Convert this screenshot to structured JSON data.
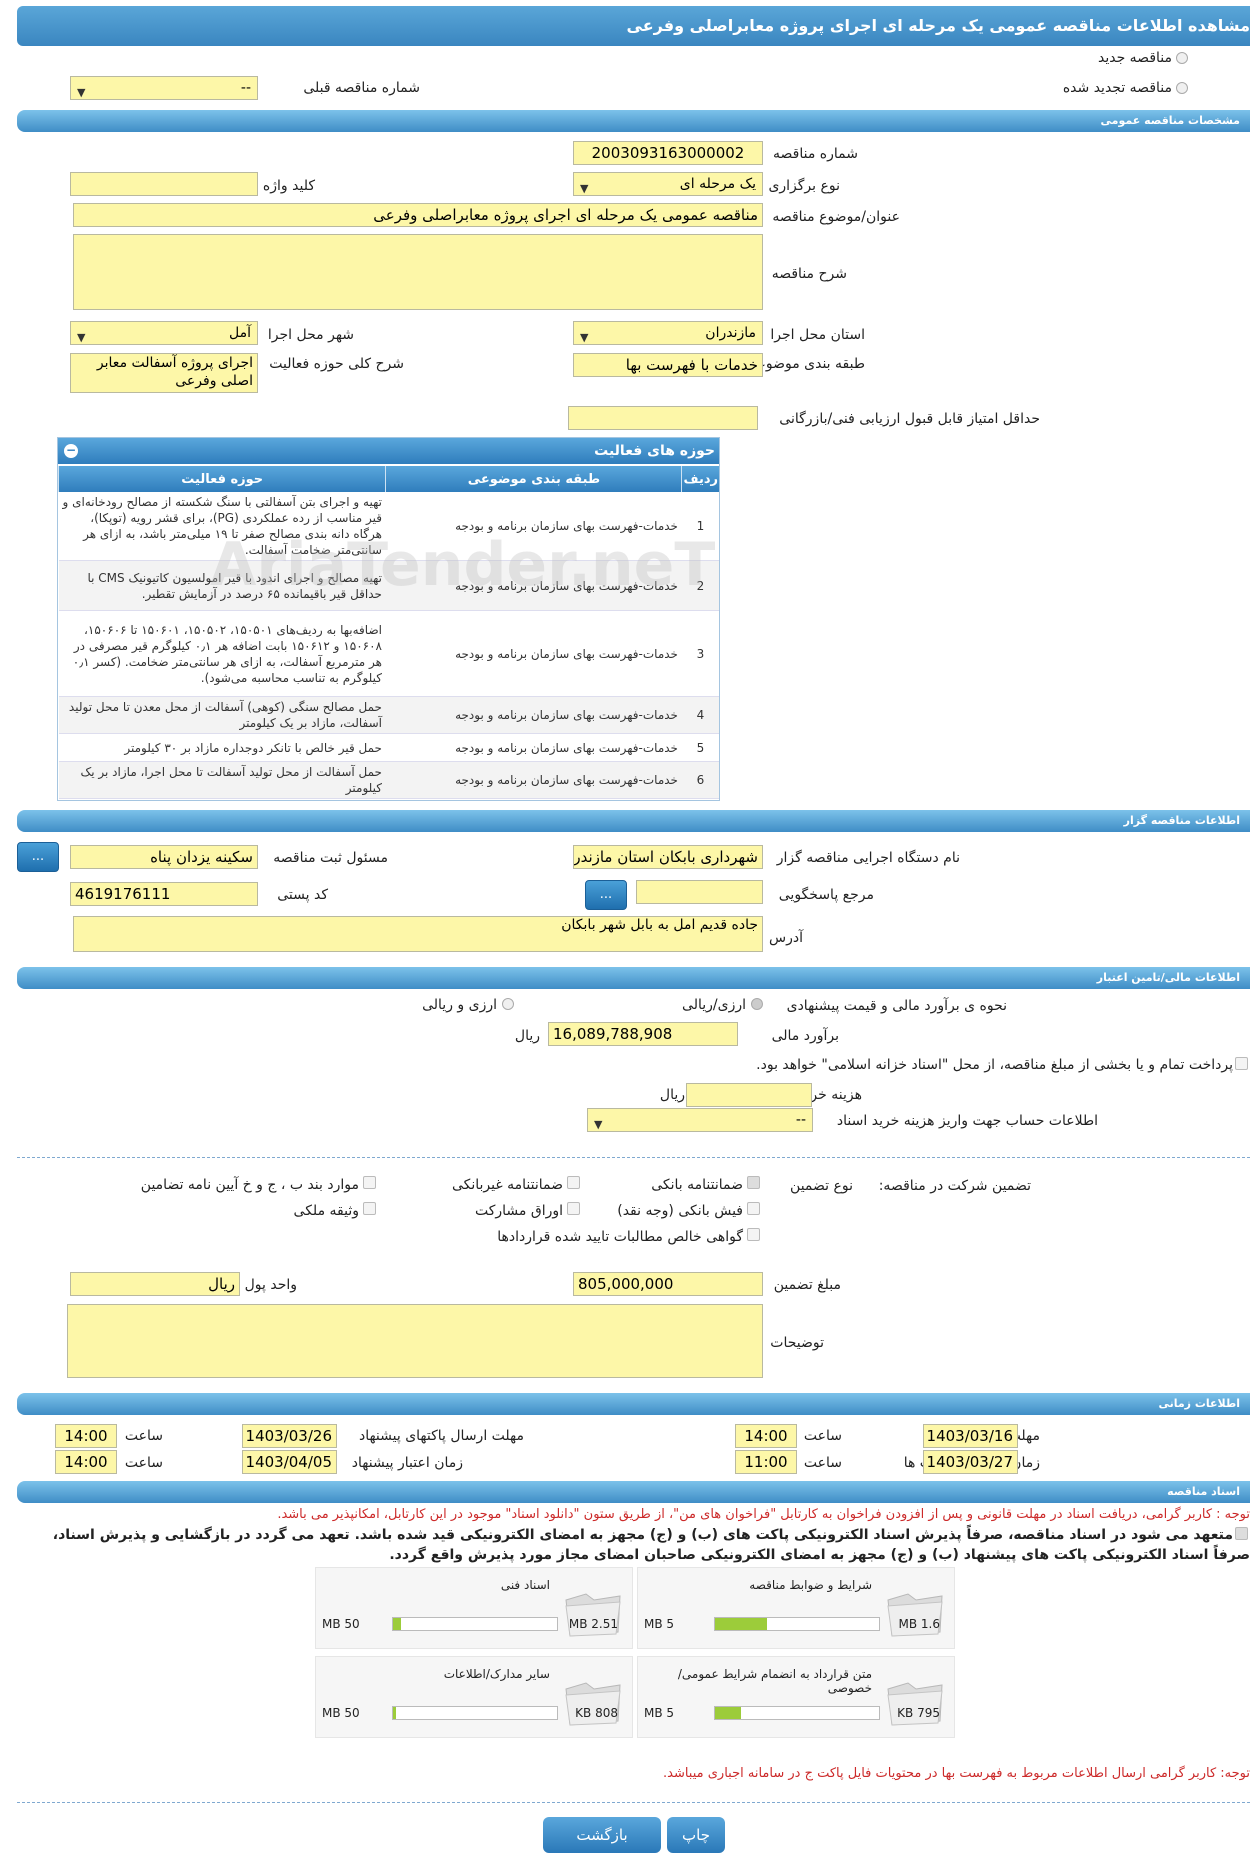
{
  "page": {
    "title": "مشاهده اطلاعات مناقصه عمومی یک مرحله ای اجرای پروژه معابراصلی وفرعی"
  },
  "top": {
    "new_tender": "مناقصه جدید",
    "renewed_tender": "مناقصه تجدید شده",
    "previous_tender_label": "شماره مناقصه قبلی",
    "previous_tender_value": "--"
  },
  "sections": {
    "general": "مشخصات مناقصه عمومی",
    "organizer": "اطلاعات مناقصه گزار",
    "financial": "اطلاعات مالی/تامین اعتبار",
    "timing": "اطلاعات زمانی",
    "documents": "اسناد مناقصه"
  },
  "general": {
    "tender_number_label": "شماره مناقصه",
    "tender_number": "2003093163000002",
    "type_label": "نوع برگزاری",
    "type_value": "یک مرحله ای",
    "keyword_label": "کلید واژه",
    "keyword_value": "",
    "subject_label": "عنوان/موضوع مناقصه",
    "subject_value": "مناقصه عمومی یک مرحله ای اجرای پروژه معابراصلی وفرعی",
    "description_label": "شرح مناقصه",
    "province_label": "استان محل اجرا",
    "province_value": "مازندران",
    "city_label": "شهر محل اجرا",
    "city_value": "آمل",
    "category_label": "طبقه بندی موضوعی",
    "category_value": "خدمات با فهرست بها",
    "activity_desc_label": "شرح کلی حوزه فعالیت",
    "activity_desc_value": "اجرای پروژه آسفالت معابر اصلی وفرعی",
    "min_score_label": "حداقل امتیاز قابل قبول ارزیابی فنی/بازرگانی"
  },
  "activities": {
    "title": "حوزه های فعالیت",
    "headers": [
      "ردیف",
      "طبقه بندی موضوعی",
      "حوزه فعالیت"
    ],
    "rows": [
      [
        "1",
        "خدمات-فهرست بهای سازمان برنامه و بودجه",
        "تهیه و اجرای بتن آسفالتی با سنگ شکسته از مصالح رودخانه‌ای و قیر مناسب از رده عملکردی (PG)، برای قشر رویه (توپکا)، هرگاه دانه بندی مصالح صفر تا ۱۹ میلی‌متر باشد، به ازای هر سانتی‌متر ضخامت آسفالت."
      ],
      [
        "2",
        "خدمات-فهرست بهای سازمان برنامه و بودجه",
        "تهیه مصالح و اجرای اندود با قیر امولسیون کاتیونیک CMS با حداقل قیر باقیمانده ۶۵ درصد در آزمایش تقطیر."
      ],
      [
        "3",
        "خدمات-فهرست بهای سازمان برنامه و بودجه",
        "اضافه‌بها به ردیف‌های ۱۵۰۵۰۱، ۱۵۰۵۰۲، ۱۵۰۶۰۱ تا ۱۵۰۶۰۶، ۱۵۰۶۰۸ و ۱۵۰۶۱۲ بابت اضافه هر ۰٫۱ کیلوگرم قیر مصرفی در هر مترمربع آسفالت، به ازای هر سانتی‌متر ضخامت. (کسر ۰٫۱ کیلوگرم به تناسب محاسبه می‌شود)."
      ],
      [
        "4",
        "خدمات-فهرست بهای سازمان برنامه و بودجه",
        "حمل مصالح سنگی (کوهی) آسفالت از محل معدن تا محل تولید آسفالت، مازاد بر یک کیلومتر"
      ],
      [
        "5",
        "خدمات-فهرست بهای سازمان برنامه و بودجه",
        "حمل قیر خالص با تانکر دوجداره مازاد بر ۳۰ کیلومتر"
      ],
      [
        "6",
        "خدمات-فهرست بهای سازمان برنامه و بودجه",
        "حمل آسفالت از محل تولید آسفالت تا محل اجرا، مازاد بر یک کیلومتر"
      ]
    ]
  },
  "organizer": {
    "agency_label": "نام دستگاه اجرایی مناقصه گزار",
    "agency_value": "شهرداری بابکان استان مازندران",
    "registrar_label": "مسئول ثبت مناقصه",
    "registrar_value": "سکینه یزدان پناه",
    "reference_label": "مرجع پاسخگویی",
    "postal_label": "کد پستی",
    "postal_value": "4619176111",
    "address_label": "آدرس",
    "address_value": "جاده قدیم امل به بابل شهر بابکان",
    "dots": "..."
  },
  "financial": {
    "estimate_method_label": "نحوه ی برآورد مالی و قیمت پیشنهادی",
    "opt_rial": "ارزی/ریالی",
    "opt_both": "ارزی و ریالی",
    "estimate_label": "برآورد مالی",
    "estimate_value": "16,089,788,908",
    "rial": "ریال",
    "treasury_text": "پرداخت تمام و یا بخشی از مبلغ مناقصه، از محل \"اسناد خزانه اسلامی\" خواهد بود.",
    "doc_fee_label": "هزینه خرید اسناد",
    "account_label": "اطلاعات حساب جهت واریز هزینه خرید اسناد",
    "account_value": "--"
  },
  "guarantee": {
    "label": "تضمین شرکت در مناقصه:",
    "type_label": "نوع تضمین",
    "options": [
      "ضمانتنامه بانکی",
      "ضمانتنامه غیربانکی",
      "موارد بند ب ، ج و خ آیین نامه تضامین",
      "فیش بانکی (وجه نقد)",
      "اوراق مشارکت",
      "وثیقه ملکی",
      "گواهی خالص مطالبات تایید شده قراردادها"
    ],
    "amount_label": "مبلغ تضمین",
    "amount_value": "805,000,000",
    "currency_label": "واحد پول",
    "currency_value": "ریال",
    "notes_label": "توضیحات"
  },
  "timing": {
    "receive_label": "مهلت دریافت اسناد",
    "receive_date": "1403/03/16",
    "receive_time": "14:00",
    "submit_label": "مهلت ارسال پاکتهای پیشنهاد",
    "submit_date": "1403/03/26",
    "submit_time": "14:00",
    "open_label": "زمان بازگشایی پاکت ها",
    "open_date": "1403/03/27",
    "open_time": "11:00",
    "valid_label": "زمان اعتبار پیشنهاد",
    "valid_date": "1403/04/05",
    "valid_time": "14:00",
    "time_label": "ساعت"
  },
  "documents": {
    "note1": "توجه : کاربر گرامی، دریافت اسناد در مهلت قانونی و پس از افزودن فراخوان به کارتابل \"فراخوان های من\"، از طریق ستون \"دانلود اسناد\" موجود در این کارتابل، امکانپذیر می باشد.",
    "commit1": "متعهد می شود در اسناد مناقصه، صرفاً پذیرش اسناد الکترونیکی پاکت های (ب) و (ج) مجهز به امضای الکترونیکی قید شده باشد. تعهد می گردد در بازگشایی و پذیرش اسناد،",
    "commit2": "صرفاً اسناد الکترونیکی پاکت های پیشنهاد (ب) و (ج) مجهز به امضای الکترونیکی صاحبان امضای مجاز مورد پذیرش واقع گردد.",
    "files": [
      {
        "title": "شرایط و ضوابط مناقصه",
        "size": "1.6 MB",
        "max": "5 MB",
        "ratio": 0.32
      },
      {
        "title": "اسناد فنی",
        "size": "2.51 MB",
        "max": "50 MB",
        "ratio": 0.05
      },
      {
        "title": "متن قرارداد به انضمام شرایط عمومی/خصوصی",
        "size": "795 KB",
        "max": "5 MB",
        "ratio": 0.16
      },
      {
        "title": "سایر مدارک/اطلاعات",
        "size": "808 KB",
        "max": "50 MB",
        "ratio": 0.02
      }
    ],
    "note2": "توجه: کاربر گرامی ارسال اطلاعات مربوط به فهرست بها در محتویات فایل پاکت ج در سامانه اجباری میباشد."
  },
  "buttons": {
    "print": "چاپ",
    "back": "بازگشت"
  },
  "watermark": "AriaTender.neT"
}
